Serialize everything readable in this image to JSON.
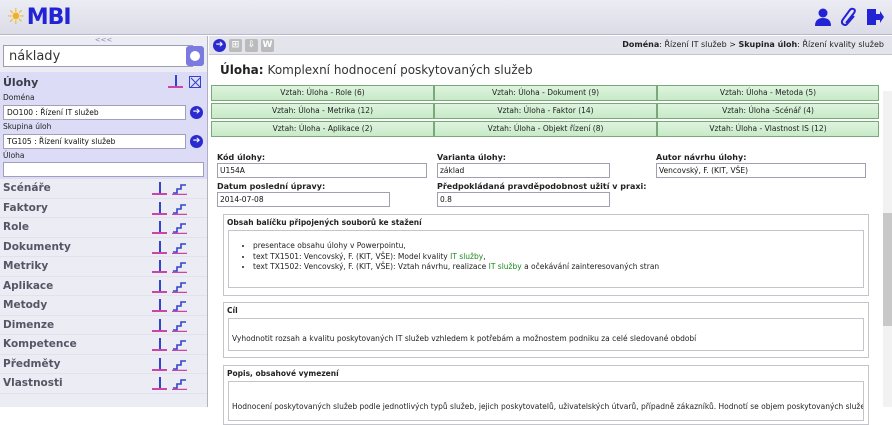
{
  "app": {
    "logo_text": "MBI"
  },
  "sidebar": {
    "collapse_label": "<<<",
    "search": {
      "value": "náklady"
    },
    "ulohy": {
      "title": "Úlohy",
      "fields": [
        {
          "label": "Doména",
          "value": "DO100 : Řízení IT služeb"
        },
        {
          "label": "Skupina úloh",
          "value": "TG105 : Řízení kvality služeb"
        },
        {
          "label": "Úloha",
          "value": ""
        }
      ]
    },
    "items": [
      {
        "label": "Scénáře"
      },
      {
        "label": "Faktory"
      },
      {
        "label": "Role"
      },
      {
        "label": "Dokumenty"
      },
      {
        "label": "Metriky"
      },
      {
        "label": "Aplikace"
      },
      {
        "label": "Metody"
      },
      {
        "label": "Dimenze"
      },
      {
        "label": "Kompetence"
      },
      {
        "label": "Předměty"
      },
      {
        "label": "Vlastnosti"
      }
    ]
  },
  "toolbar": {
    "breadcrumb": {
      "domain_label": "Doména",
      "domain_value": "Řízení IT služeb",
      "group_label": "Skupina úloh",
      "group_value": "Řízení kvality služeb"
    }
  },
  "page": {
    "title_label": "Úloha:",
    "title_value": "Komplexní hodnocení poskytovaných služeb"
  },
  "relations": [
    "Vztah: Úloha - Role (6)",
    "Vztah: Úloha - Dokument (9)",
    "Vztah: Úloha - Metoda (5)",
    "Vztah: Úloha - Metrika (12)",
    "Vztah: Úloha - Faktor (14)",
    "Vztah: Úloha -Scénář (4)",
    "Vztah: Úloha - Aplikace (2)",
    "Vztah: Úloha - Objekt řízení (8)",
    "Vztah: Úloha - Vlastnost IS (12)"
  ],
  "form": {
    "kod_label": "Kód úlohy:",
    "kod_value": "U154A",
    "varianta_label": "Varianta úlohy:",
    "varianta_value": "základ",
    "autor_label": "Autor návrhu úlohy:",
    "autor_value": "Vencovský, F. (KIT, VŠE)",
    "datum_label": "Datum poslední úpravy:",
    "datum_value": "2014-07-08",
    "pravd_label": "Předpokládaná pravděpodobnost užití v praxi:",
    "pravd_value": "0.8",
    "obsah_title": "Obsah balíčku připojených souborů ke stažení",
    "obsah_items": [
      {
        "pre": "presentace obsahu úlohy v Powerpointu,",
        "hl": "",
        "post": ""
      },
      {
        "pre": "text TX1501: Vencovský, F. (KIT, VŠE): Model kvality ",
        "hl": "IT služby",
        "post": ","
      },
      {
        "pre": "text TX1502: Vencovský, F. (KIT, VŠE): Vztah návrhu, realizace ",
        "hl": "IT služby",
        "post": " a očekávání zainteresovaných stran"
      }
    ],
    "cil_title": "Cíl",
    "cil_text": "Vyhodnotit rozsah a kvalitu poskytovaných IT služeb vzhledem k potřebám a možnostem podniku za celé sledované období",
    "popis_title": "Popis, obsahové vymezení",
    "popis_text": "Hodnocení poskytovaných služeb podle jednotlivých typů služeb, jejich poskytovatelů, uživatelských útvarů, případně zákazníků. Hodnotí se objem poskytovaných služeb"
  },
  "colors": {
    "brand": "#2323d6",
    "relation_bg": "#d4f0d4",
    "highlight": "#1a8a1a"
  }
}
